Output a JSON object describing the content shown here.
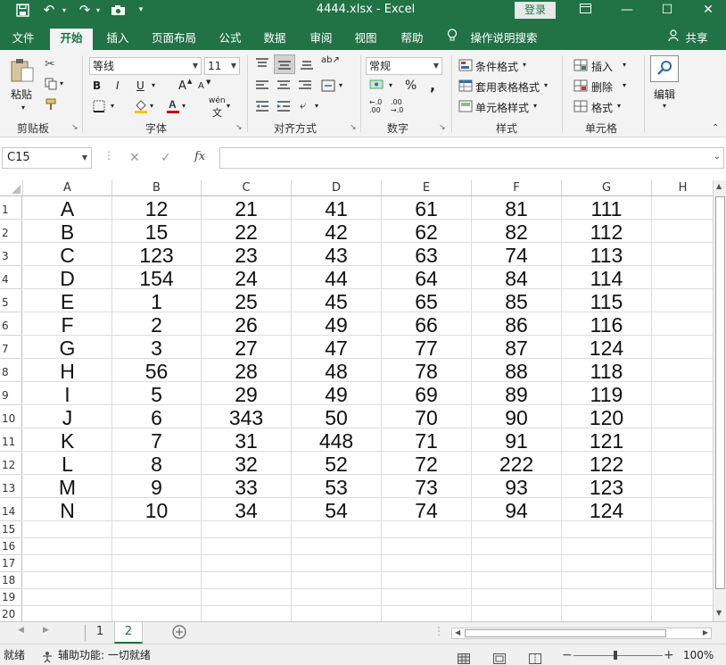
{
  "titlebar": {
    "title": "4444.xlsx  -  Excel",
    "login": "登录",
    "icons": [
      "save-icon",
      "undo-icon",
      "redo-icon",
      "camera-icon",
      "customize-qat-icon"
    ],
    "ribbon_display_icon": "ribbon-display-options-icon",
    "minimize": "—",
    "maximize": "☐",
    "close": "✕",
    "accent": "#217346"
  },
  "tabs": {
    "file": "文件",
    "home": "开始",
    "insert": "插入",
    "layout": "页面布局",
    "formulas": "公式",
    "data": "数据",
    "review": "审阅",
    "view": "视图",
    "help": "帮助",
    "tell_me": "操作说明搜索",
    "share": "共享"
  },
  "ribbon": {
    "clipboard": {
      "paste": "粘贴",
      "label": "剪贴板"
    },
    "font": {
      "name": "等线",
      "size": "11",
      "bold": "B",
      "italic": "I",
      "underline": "U",
      "grow": "A",
      "shrink": "A",
      "wen": "wén",
      "label": "字体"
    },
    "alignment": {
      "label": "对齐方式"
    },
    "number": {
      "format": "常规",
      "percent": "%",
      "comma": ",",
      "label": "数字"
    },
    "styles": {
      "conditional": "条件格式",
      "table": "套用表格格式",
      "cell": "单元格样式",
      "label": "样式"
    },
    "cells": {
      "insert": "插入",
      "delete": "删除",
      "format": "格式",
      "label": "单元格"
    },
    "editing": {
      "label": "编辑"
    }
  },
  "formula_bar": {
    "name_box": "C15",
    "fx": "fx",
    "cancel": "✕",
    "enter": "✓",
    "value": ""
  },
  "columns": [
    "A",
    "B",
    "C",
    "D",
    "E",
    "F",
    "G",
    "H"
  ],
  "rows": [
    [
      "A",
      "12",
      "21",
      "41",
      "61",
      "81",
      "111",
      ""
    ],
    [
      "B",
      "15",
      "22",
      "42",
      "62",
      "82",
      "112",
      ""
    ],
    [
      "C",
      "123",
      "23",
      "43",
      "63",
      "74",
      "113",
      ""
    ],
    [
      "D",
      "154",
      "24",
      "44",
      "64",
      "84",
      "114",
      ""
    ],
    [
      "E",
      "1",
      "25",
      "45",
      "65",
      "85",
      "115",
      ""
    ],
    [
      "F",
      "2",
      "26",
      "49",
      "66",
      "86",
      "116",
      ""
    ],
    [
      "G",
      "3",
      "27",
      "47",
      "77",
      "87",
      "124",
      ""
    ],
    [
      "H",
      "56",
      "28",
      "48",
      "78",
      "88",
      "118",
      ""
    ],
    [
      "I",
      "5",
      "29",
      "49",
      "69",
      "89",
      "119",
      ""
    ],
    [
      "J",
      "6",
      "343",
      "50",
      "70",
      "90",
      "120",
      ""
    ],
    [
      "K",
      "7",
      "31",
      "448",
      "71",
      "91",
      "121",
      ""
    ],
    [
      "L",
      "8",
      "32",
      "52",
      "72",
      "222",
      "122",
      ""
    ],
    [
      "M",
      "9",
      "33",
      "53",
      "73",
      "93",
      "123",
      ""
    ],
    [
      "N",
      "10",
      "34",
      "54",
      "74",
      "94",
      "124",
      ""
    ]
  ],
  "empty_rows": [
    "15",
    "16",
    "17",
    "18",
    "19",
    "20"
  ],
  "sheets": [
    "1",
    "2"
  ],
  "active_sheet": "2",
  "status": {
    "ready": "就绪",
    "accessibility": "辅助功能: 一切就绪",
    "zoom": "100%"
  }
}
